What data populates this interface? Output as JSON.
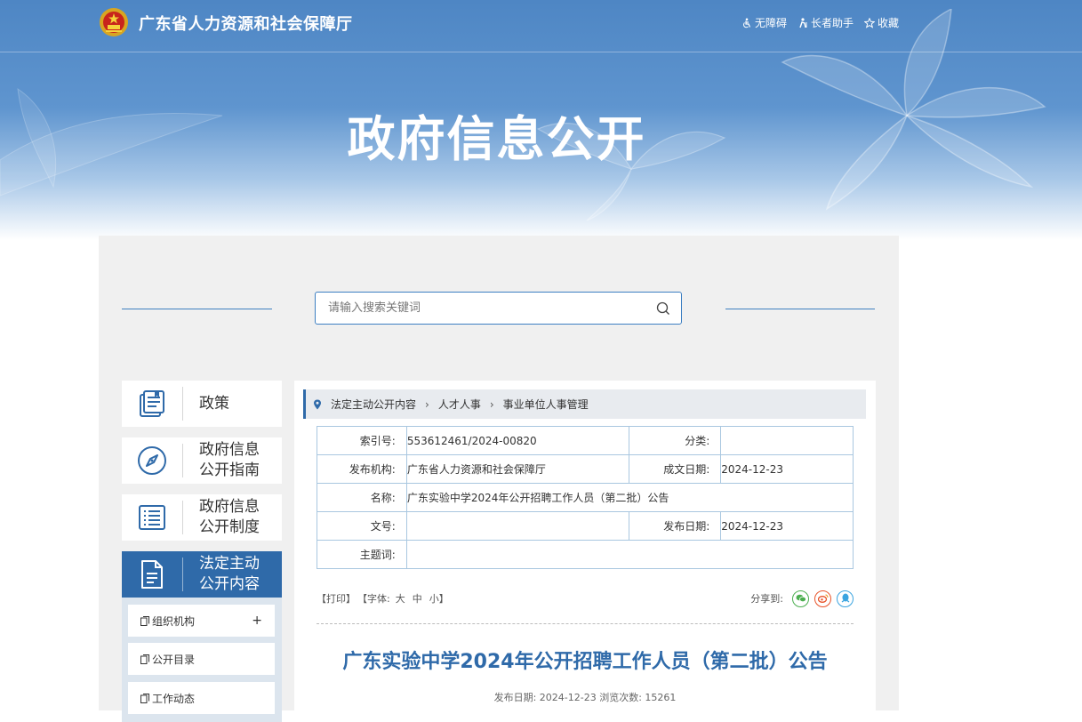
{
  "header": {
    "site_title": "广东省人力资源和社会保障厅",
    "tools": {
      "accessibility": "无障碍",
      "elder_helper": "长者助手",
      "favorite": "收藏"
    },
    "hero_title": "政府信息公开"
  },
  "search": {
    "placeholder": "请输入搜索关键词",
    "value": ""
  },
  "sidebar": {
    "items": [
      {
        "label": "政策",
        "icon": "policy-book-icon",
        "active": false
      },
      {
        "label_line1": "政府信息",
        "label_line2": "公开指南",
        "icon": "compass-icon",
        "active": false
      },
      {
        "label_line1": "政府信息",
        "label_line2": "公开制度",
        "icon": "list-icon",
        "active": false
      },
      {
        "label_line1": "法定主动",
        "label_line2": "公开内容",
        "icon": "document-icon",
        "active": true
      }
    ],
    "sub_items": [
      {
        "label": "组织机构",
        "expand": "+"
      },
      {
        "label": "公开目录"
      },
      {
        "label": "工作动态"
      }
    ]
  },
  "breadcrumb": {
    "items": [
      "法定主动公开内容",
      "人才人事",
      "事业单位人事管理"
    ]
  },
  "meta": {
    "index_no": {
      "key": "索引号:",
      "value": "553612461/2024-00820"
    },
    "category": {
      "key": "分类:",
      "value": ""
    },
    "publisher": {
      "key": "发布机构:",
      "value": "广东省人力资源和社会保障厅"
    },
    "created": {
      "key": "成文日期:",
      "value": "2024-12-23"
    },
    "name": {
      "key": "名称:",
      "value": "广东实验中学2024年公开招聘工作人员（第二批）公告"
    },
    "doc_no": {
      "key": "文号:",
      "value": ""
    },
    "published": {
      "key": "发布日期:",
      "value": "2024-12-23"
    },
    "subject": {
      "key": "主题词:",
      "value": ""
    }
  },
  "article_tools": {
    "print": "【打印】",
    "font_prefix": "【字体:",
    "font_large": "大",
    "font_medium": "中",
    "font_small": "小",
    "font_suffix": "】",
    "share_label": "分享到:",
    "share_icons": [
      "wechat-icon",
      "weibo-icon",
      "qq-icon"
    ]
  },
  "article": {
    "title": "广东实验中学2024年公开招聘工作人员（第二批）公告",
    "meta": "发布日期: 2024-12-23  浏览次数: 15261"
  },
  "colors": {
    "primary": "#2f6aa9",
    "banner": "#4e86c4",
    "panel_bg": "#f0f0f0"
  }
}
